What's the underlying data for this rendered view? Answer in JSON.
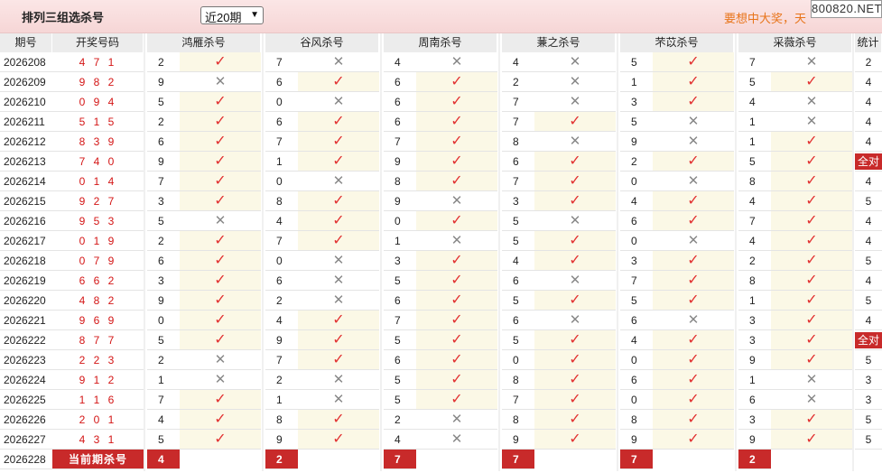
{
  "header": {
    "title": "排列三组选杀号",
    "period_select": "近20期",
    "marquee": "要想中大奖，天",
    "site_badge": "800820.NET"
  },
  "columns": {
    "period": "期号",
    "draw": "开奖号码",
    "experts": [
      "鸿雁杀号",
      "谷风杀号",
      "周南杀号",
      "蒹之杀号",
      "芣苡杀号",
      "采薇杀号"
    ],
    "stat": "统计"
  },
  "rows": [
    {
      "period": "2026208",
      "draw": "4 7 1",
      "picks": [
        [
          2,
          1
        ],
        [
          7,
          0
        ],
        [
          4,
          0
        ],
        [
          4,
          0
        ],
        [
          5,
          1
        ],
        [
          7,
          0
        ]
      ],
      "stat": "2"
    },
    {
      "period": "2026209",
      "draw": "9 8 2",
      "picks": [
        [
          9,
          0
        ],
        [
          6,
          1
        ],
        [
          6,
          1
        ],
        [
          2,
          0
        ],
        [
          1,
          1
        ],
        [
          5,
          1
        ]
      ],
      "stat": "4"
    },
    {
      "period": "2026210",
      "draw": "0 9 4",
      "picks": [
        [
          5,
          1
        ],
        [
          0,
          0
        ],
        [
          6,
          1
        ],
        [
          7,
          0
        ],
        [
          3,
          1
        ],
        [
          4,
          0
        ]
      ],
      "stat": "4"
    },
    {
      "period": "2026211",
      "draw": "5 1 5",
      "picks": [
        [
          2,
          1
        ],
        [
          6,
          1
        ],
        [
          6,
          1
        ],
        [
          7,
          1
        ],
        [
          5,
          0
        ],
        [
          1,
          0
        ]
      ],
      "stat": "4"
    },
    {
      "period": "2026212",
      "draw": "8 3 9",
      "picks": [
        [
          6,
          1
        ],
        [
          7,
          1
        ],
        [
          7,
          1
        ],
        [
          8,
          0
        ],
        [
          9,
          0
        ],
        [
          1,
          1
        ]
      ],
      "stat": "4"
    },
    {
      "period": "2026213",
      "draw": "7 4 0",
      "picks": [
        [
          9,
          1
        ],
        [
          1,
          1
        ],
        [
          9,
          1
        ],
        [
          6,
          1
        ],
        [
          2,
          1
        ],
        [
          5,
          1
        ]
      ],
      "stat": "全对"
    },
    {
      "period": "2026214",
      "draw": "0 1 4",
      "picks": [
        [
          7,
          1
        ],
        [
          0,
          0
        ],
        [
          8,
          1
        ],
        [
          7,
          1
        ],
        [
          0,
          0
        ],
        [
          8,
          1
        ]
      ],
      "stat": "4"
    },
    {
      "period": "2026215",
      "draw": "9 2 7",
      "picks": [
        [
          3,
          1
        ],
        [
          8,
          1
        ],
        [
          9,
          0
        ],
        [
          3,
          1
        ],
        [
          4,
          1
        ],
        [
          4,
          1
        ]
      ],
      "stat": "5"
    },
    {
      "period": "2026216",
      "draw": "9 5 3",
      "picks": [
        [
          5,
          0
        ],
        [
          4,
          1
        ],
        [
          0,
          1
        ],
        [
          5,
          0
        ],
        [
          6,
          1
        ],
        [
          7,
          1
        ]
      ],
      "stat": "4"
    },
    {
      "period": "2026217",
      "draw": "0 1 9",
      "picks": [
        [
          2,
          1
        ],
        [
          7,
          1
        ],
        [
          1,
          0
        ],
        [
          5,
          1
        ],
        [
          0,
          0
        ],
        [
          4,
          1
        ]
      ],
      "stat": "4"
    },
    {
      "period": "2026218",
      "draw": "0 7 9",
      "picks": [
        [
          6,
          1
        ],
        [
          0,
          0
        ],
        [
          3,
          1
        ],
        [
          4,
          1
        ],
        [
          3,
          1
        ],
        [
          2,
          1
        ]
      ],
      "stat": "5"
    },
    {
      "period": "2026219",
      "draw": "6 6 2",
      "picks": [
        [
          3,
          1
        ],
        [
          6,
          0
        ],
        [
          5,
          1
        ],
        [
          6,
          0
        ],
        [
          7,
          1
        ],
        [
          8,
          1
        ]
      ],
      "stat": "4"
    },
    {
      "period": "2026220",
      "draw": "4 8 2",
      "picks": [
        [
          9,
          1
        ],
        [
          2,
          0
        ],
        [
          6,
          1
        ],
        [
          5,
          1
        ],
        [
          5,
          1
        ],
        [
          1,
          1
        ]
      ],
      "stat": "5"
    },
    {
      "period": "2026221",
      "draw": "9 6 9",
      "picks": [
        [
          0,
          1
        ],
        [
          4,
          1
        ],
        [
          7,
          1
        ],
        [
          6,
          0
        ],
        [
          6,
          0
        ],
        [
          3,
          1
        ]
      ],
      "stat": "4"
    },
    {
      "period": "2026222",
      "draw": "8 7 7",
      "picks": [
        [
          5,
          1
        ],
        [
          9,
          1
        ],
        [
          5,
          1
        ],
        [
          5,
          1
        ],
        [
          4,
          1
        ],
        [
          3,
          1
        ]
      ],
      "stat": "全对"
    },
    {
      "period": "2026223",
      "draw": "2 2 3",
      "picks": [
        [
          2,
          0
        ],
        [
          7,
          1
        ],
        [
          6,
          1
        ],
        [
          0,
          1
        ],
        [
          0,
          1
        ],
        [
          9,
          1
        ]
      ],
      "stat": "5"
    },
    {
      "period": "2026224",
      "draw": "9 1 2",
      "picks": [
        [
          1,
          0
        ],
        [
          2,
          0
        ],
        [
          5,
          1
        ],
        [
          8,
          1
        ],
        [
          6,
          1
        ],
        [
          1,
          0
        ]
      ],
      "stat": "3"
    },
    {
      "period": "2026225",
      "draw": "1 1 6",
      "picks": [
        [
          7,
          1
        ],
        [
          1,
          0
        ],
        [
          5,
          1
        ],
        [
          7,
          1
        ],
        [
          0,
          1
        ],
        [
          6,
          0
        ]
      ],
      "stat": "3"
    },
    {
      "period": "2026226",
      "draw": "2 0 1",
      "picks": [
        [
          4,
          1
        ],
        [
          8,
          1
        ],
        [
          2,
          0
        ],
        [
          8,
          1
        ],
        [
          8,
          1
        ],
        [
          3,
          1
        ]
      ],
      "stat": "5"
    },
    {
      "period": "2026227",
      "draw": "4 3 1",
      "picks": [
        [
          5,
          1
        ],
        [
          9,
          1
        ],
        [
          4,
          0
        ],
        [
          9,
          1
        ],
        [
          9,
          1
        ],
        [
          9,
          1
        ]
      ],
      "stat": "5"
    }
  ],
  "current": {
    "period": "2026228",
    "label": "当前期杀号",
    "picks": [
      4,
      2,
      7,
      7,
      7,
      2
    ]
  },
  "icons": {
    "ok": "✓",
    "no": "✕"
  },
  "colors": {
    "accent": "#c82a2a",
    "hit": "#e23131",
    "header_bg": "#f6d6d6"
  }
}
